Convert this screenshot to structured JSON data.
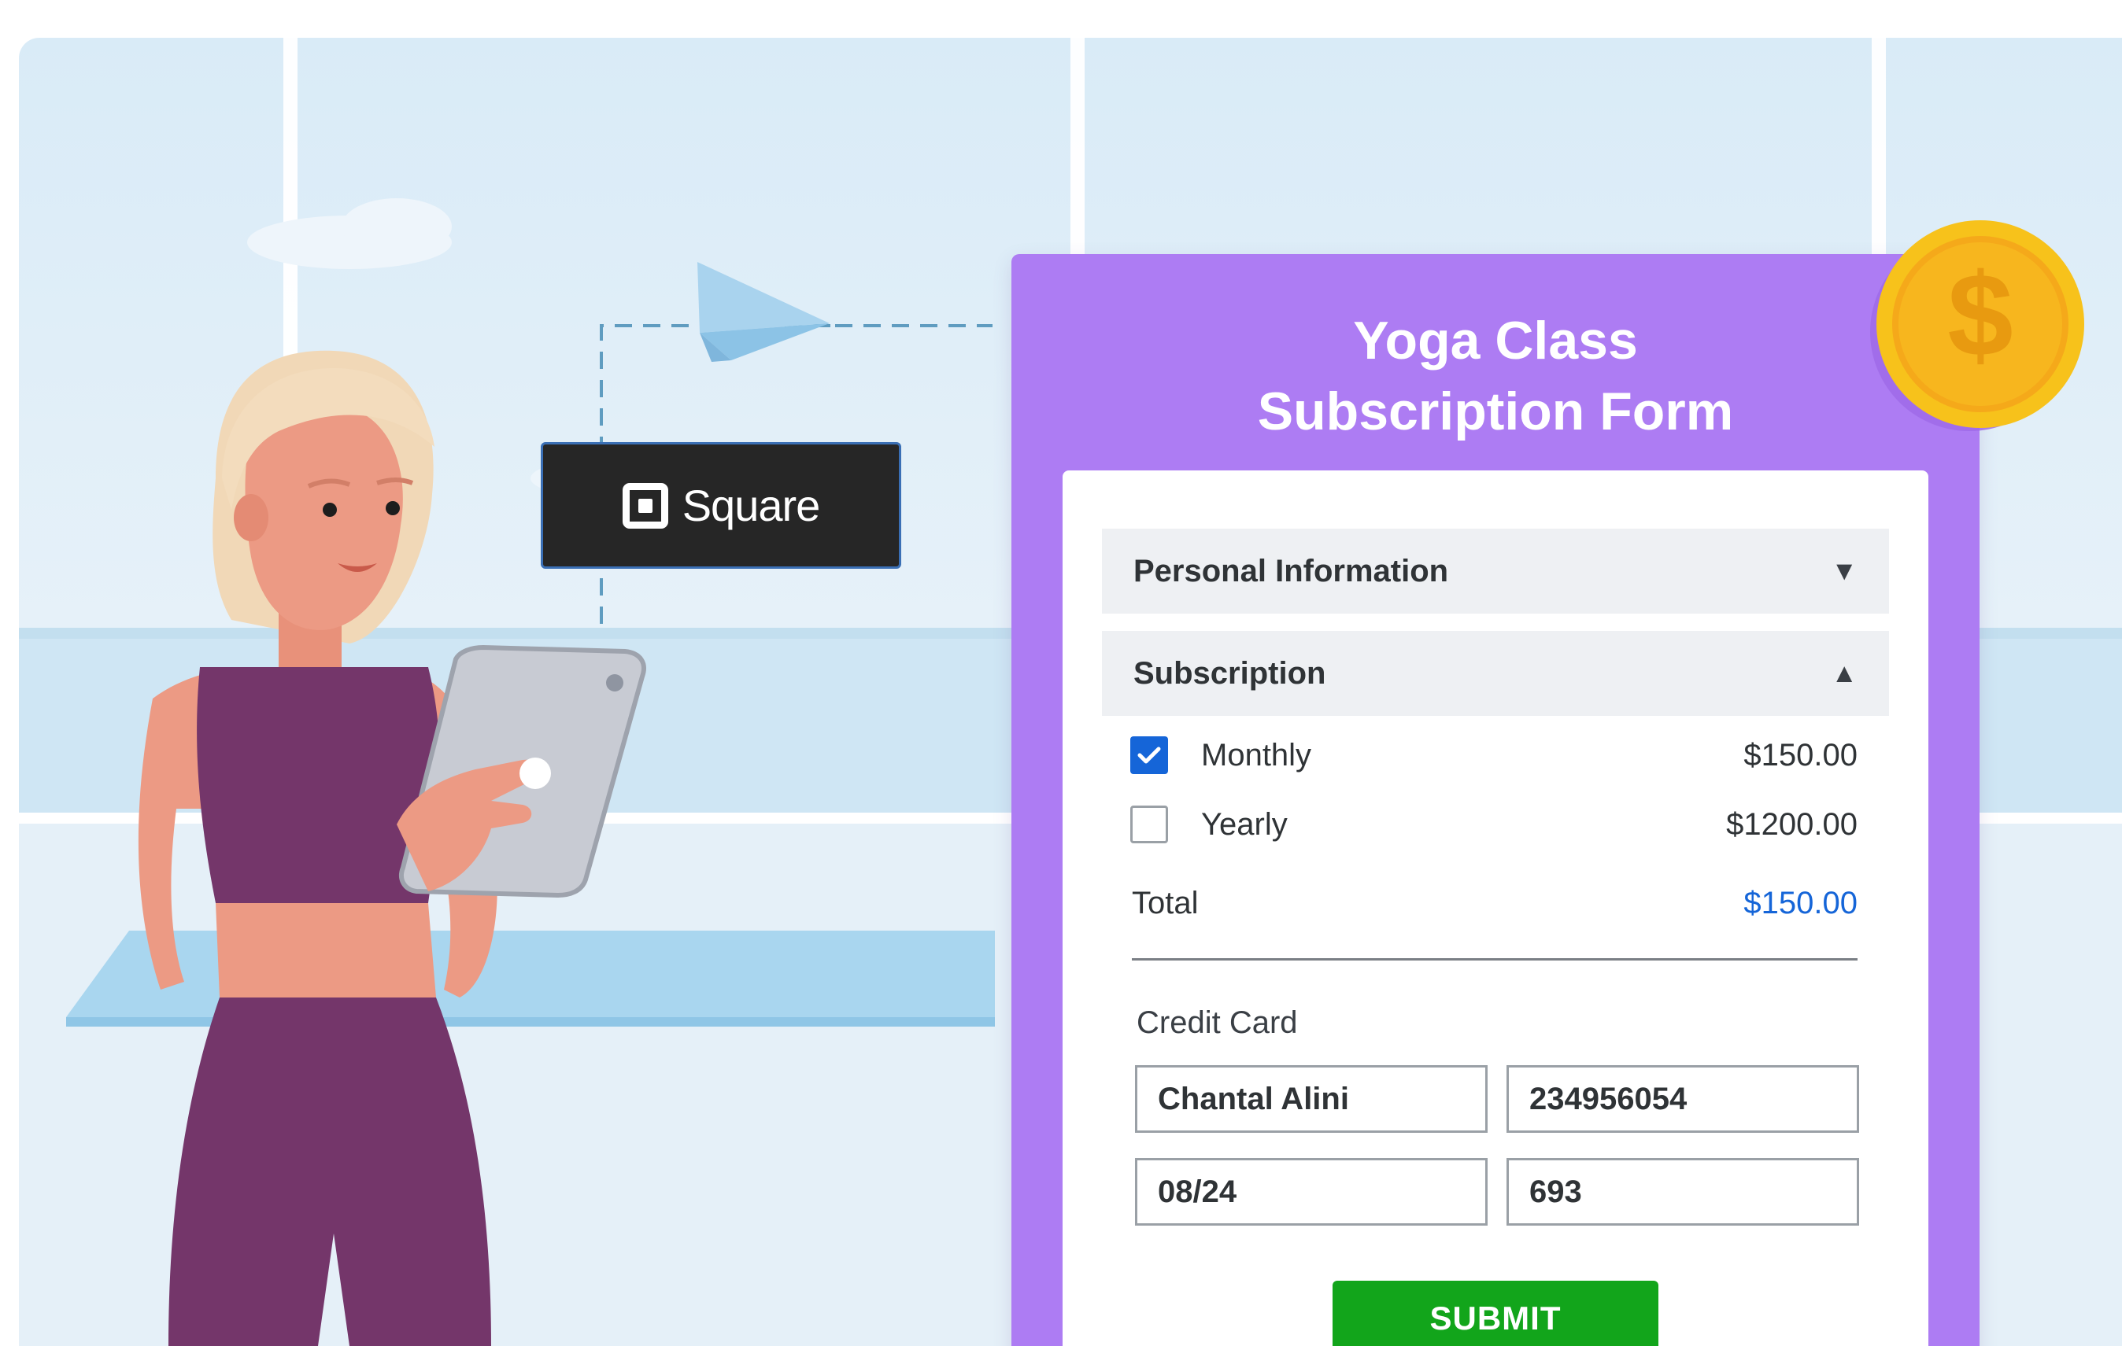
{
  "brand": {
    "name": "Square",
    "icon": "square-logo-icon"
  },
  "form": {
    "title_line1": "Yoga Class",
    "title_line2": "Subscription Form",
    "accent_color": "#ad7cf3",
    "sections": {
      "personal": {
        "label": "Personal Information",
        "arrow": "▼",
        "expanded": false
      },
      "subscription": {
        "label": "Subscription",
        "arrow": "▲",
        "expanded": true
      }
    },
    "plans": [
      {
        "label": "Monthly",
        "price": "$150.00",
        "checked": true
      },
      {
        "label": "Yearly",
        "price": "$1200.00",
        "checked": false
      }
    ],
    "total": {
      "label": "Total",
      "value": "$150.00",
      "color": "#1565d8"
    },
    "credit_card": {
      "label": "Credit Card",
      "name": "Chantal Alini",
      "number": "234956054",
      "expiry": "08/24",
      "cvv": "693"
    },
    "submit_label": "SUBMIT",
    "submit_color": "#12a51b"
  },
  "decor": {
    "coin_symbol": "$",
    "coin_icon": "dollar-coin-icon",
    "plane_icon": "paper-plane-icon",
    "person": "woman-with-tablet-illustration"
  }
}
